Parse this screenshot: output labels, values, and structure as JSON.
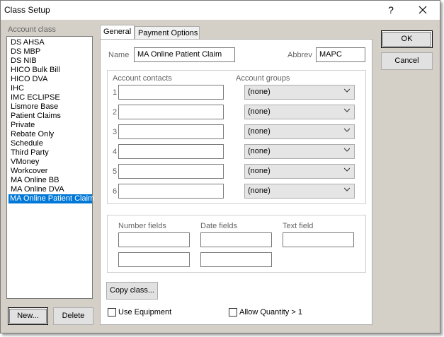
{
  "window": {
    "title": "Class Setup",
    "help": "?",
    "close": "✕"
  },
  "account_class": {
    "label": "Account class",
    "items": [
      "DS AHSA",
      "DS MBP",
      "DS NIB",
      "HICO Bulk Bill",
      "HICO DVA",
      "IHC",
      "IMC ECLIPSE",
      "Lismore Base",
      "Patient Claims",
      "Private",
      "Rebate Only",
      "Schedule",
      "Third Party",
      "VMoney",
      "Workcover",
      "MA Online BB",
      "MA Online DVA",
      "MA Online Patient Claim"
    ],
    "selected": "MA Online Patient Claim"
  },
  "buttons": {
    "new": "New...",
    "delete": "Delete",
    "ok": "OK",
    "cancel": "Cancel",
    "copy_class": "Copy class..."
  },
  "tabs": [
    "General",
    "Payment Options"
  ],
  "general": {
    "name_label": "Name",
    "name_value": "MA Online Patient Claim",
    "abbrev_label": "Abbrev",
    "abbrev_value": "MAPC",
    "contacts_label": "Account contacts",
    "groups_label": "Account groups",
    "rows": [
      {
        "num": "1",
        "contact": "",
        "group": "(none)"
      },
      {
        "num": "2",
        "contact": "",
        "group": "(none)"
      },
      {
        "num": "3",
        "contact": "",
        "group": "(none)"
      },
      {
        "num": "4",
        "contact": "",
        "group": "(none)"
      },
      {
        "num": "5",
        "contact": "",
        "group": "(none)"
      },
      {
        "num": "6",
        "contact": "",
        "group": "(none)"
      }
    ],
    "number_fields_label": "Number fields",
    "date_fields_label": "Date fields",
    "text_field_label": "Text field",
    "use_equipment": "Use Equipment",
    "allow_quantity": "Allow Quantity > 1"
  }
}
